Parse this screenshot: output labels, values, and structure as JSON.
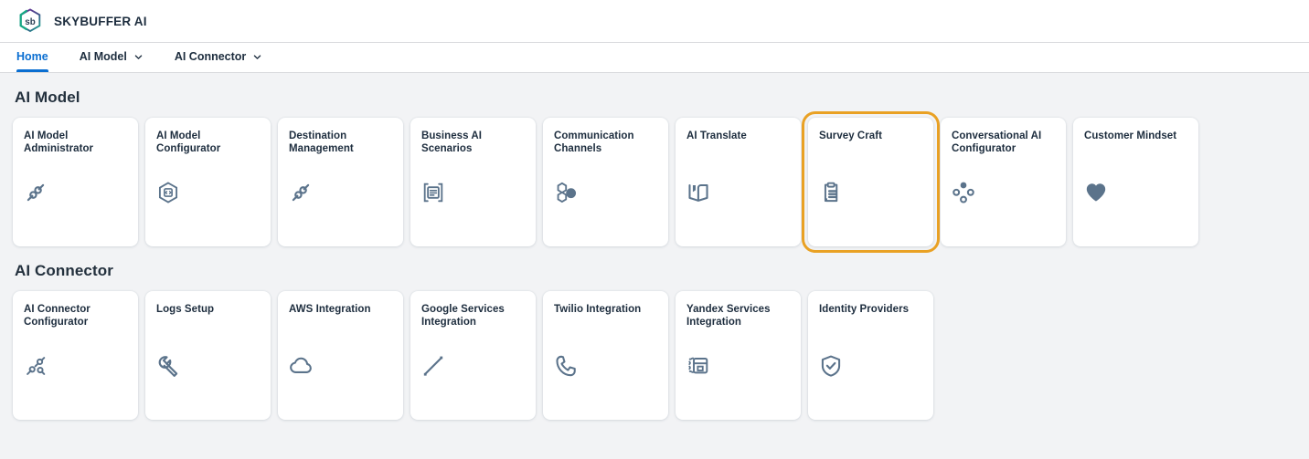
{
  "header": {
    "brand_title": "SKYBUFFER AI",
    "logo_text": "sb",
    "logo_icon": "hexagon-sb-logo"
  },
  "nav": {
    "items": [
      {
        "label": "Home",
        "active": true,
        "has_chevron": false,
        "icon": ""
      },
      {
        "label": "AI Model",
        "active": false,
        "has_chevron": true,
        "icon": "chevron-down-icon"
      },
      {
        "label": "AI Connector",
        "active": false,
        "has_chevron": true,
        "icon": "chevron-down-icon"
      }
    ]
  },
  "colors": {
    "accent_blue": "#0a6ed1",
    "focus_amber": "#e9a124",
    "icon_slate": "#5b738b",
    "page_background": "#f2f3f5",
    "tile_background": "#ffffff",
    "text_dark": "#1d2d3e"
  },
  "sections": [
    {
      "title": "AI Model",
      "tiles": [
        {
          "title": "AI Model Administrator",
          "icon": "link-node-icon",
          "selected": false
        },
        {
          "title": "AI Model Configurator",
          "icon": "hexagon-chip-icon",
          "selected": false
        },
        {
          "title": "Destination Management",
          "icon": "link-node-icon",
          "selected": false
        },
        {
          "title": "Business AI Scenarios",
          "icon": "document-lines-icon",
          "selected": false
        },
        {
          "title": "Communication Channels",
          "icon": "hexagon-cluster-icon",
          "selected": false
        },
        {
          "title": "AI Translate",
          "icon": "open-book-icon",
          "selected": false
        },
        {
          "title": "Survey Craft",
          "icon": "clipboard-list-icon",
          "selected": true
        },
        {
          "title": "Conversational AI Configurator",
          "icon": "four-dot-diamond-icon",
          "selected": false
        },
        {
          "title": "Customer Mindset",
          "icon": "heart-icon",
          "selected": false
        }
      ]
    },
    {
      "title": "AI Connector",
      "tiles": [
        {
          "title": "AI Connector Configurator",
          "icon": "double-link-node-icon",
          "selected": false
        },
        {
          "title": "Logs Setup",
          "icon": "wrench-icon",
          "selected": false
        },
        {
          "title": "AWS Integration",
          "icon": "cloud-icon",
          "selected": false
        },
        {
          "title": "Google Services Integration",
          "icon": "diagonal-line-icon",
          "selected": false
        },
        {
          "title": "Twilio Integration",
          "icon": "phone-icon",
          "selected": false
        },
        {
          "title": "Yandex Services Integration",
          "icon": "gear-window-icon",
          "selected": false
        },
        {
          "title": "Identity Providers",
          "icon": "shield-check-icon",
          "selected": false
        }
      ]
    }
  ]
}
